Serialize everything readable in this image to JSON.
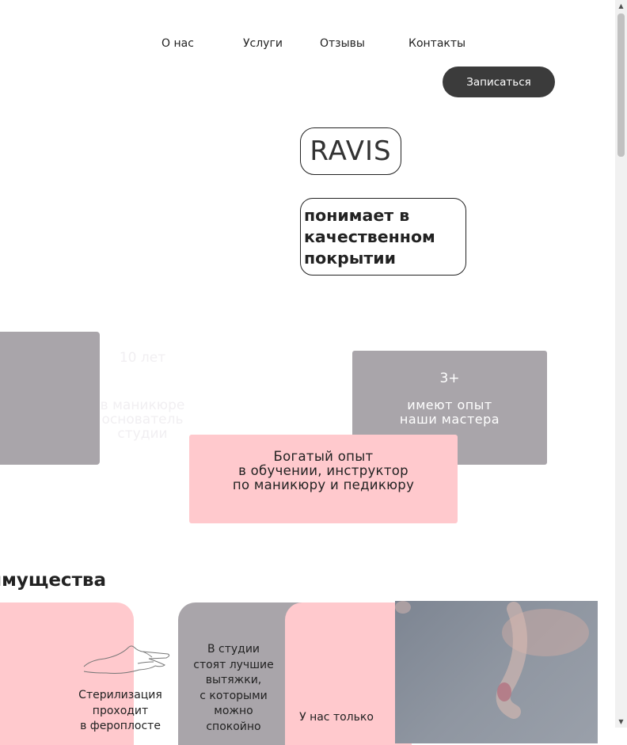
{
  "nav": {
    "items": [
      "О нас",
      "Услуги",
      "Отзывы",
      "Контакты"
    ],
    "cta_label": "Записаться"
  },
  "hero": {
    "brand": "RAVIS",
    "tagline": "понимает в качественном покрытии"
  },
  "stats": {
    "left": {
      "number": "10 лет",
      "text_lines": [
        "в маникюре",
        "основатель",
        "студии"
      ]
    },
    "right": {
      "number": "3+",
      "text_lines": [
        "имеют опыт",
        "наши мастера"
      ]
    },
    "center": {
      "text_lines": [
        "Богатый опыт",
        "в обучении, инструктор",
        "по маникюру и педикюру"
      ]
    }
  },
  "advantages": {
    "title": "имущества",
    "card1_lines": [
      "Стерилизация",
      "проходит",
      "в фероплосте"
    ],
    "card2_lines": [
      "В студии",
      "стоят лучшие",
      "вытяжки,",
      "с которыми",
      "можно",
      "спокойно"
    ],
    "card3_lines": [
      "У нас только"
    ]
  },
  "colors": {
    "pink": "#ffc9cd",
    "grey": "#a9a5aa",
    "dark_button": "#3b3b3b"
  },
  "icons": [
    "hand-line-icon",
    "scroll-up-icon",
    "scroll-down-icon"
  ]
}
